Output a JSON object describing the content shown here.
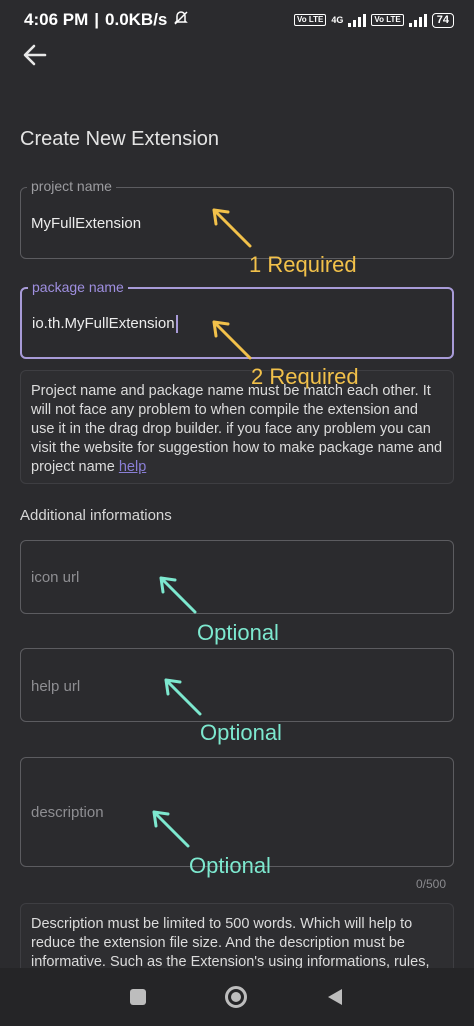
{
  "status_bar": {
    "time": "4:06 PM",
    "separator": "|",
    "speed": "0.0KB/s",
    "lte1": "Vo LTE",
    "network": "4G",
    "lte2": "Vo LTE",
    "battery": "74",
    "icons": [
      "mute-icon",
      "signal-icon",
      "battery-icon"
    ]
  },
  "header": {
    "back_icon": "arrow-left-icon"
  },
  "page": {
    "title": "Create New Extension"
  },
  "fields": {
    "project_name": {
      "label": "project name",
      "value": "MyFullExtension"
    },
    "package_name": {
      "label": "package name",
      "value": "io.th.MyFullExtension"
    },
    "icon_url": {
      "placeholder": "icon url"
    },
    "help_url": {
      "placeholder": "help url"
    },
    "description": {
      "placeholder": "description",
      "counter": "0/500"
    }
  },
  "info_box_1": {
    "text": "Project name and package name must be match each other. It will not face any problem to when compile the extension and use it in the drag drop builder. if you face any problem you can visit the website for suggestion how to make package name and project name ",
    "link": "help"
  },
  "section": {
    "additional": "Additional informations"
  },
  "info_box_2": {
    "text": "Description must be limited to 500 words.  Which will help to reduce the extension file size.  And the description must be informative.  Such as the Extension's using informations, rules,"
  },
  "annotations": {
    "required_1": "1 Required",
    "required_2": "2 Required",
    "optional_1": "Optional",
    "optional_2": "Optional",
    "optional_3": "Optional",
    "colors": {
      "required": "#f2c14a",
      "optional": "#7de8cf"
    }
  },
  "nav_bar": {
    "icons": [
      "recents-square-icon",
      "home-circle-icon",
      "back-triangle-icon"
    ]
  }
}
